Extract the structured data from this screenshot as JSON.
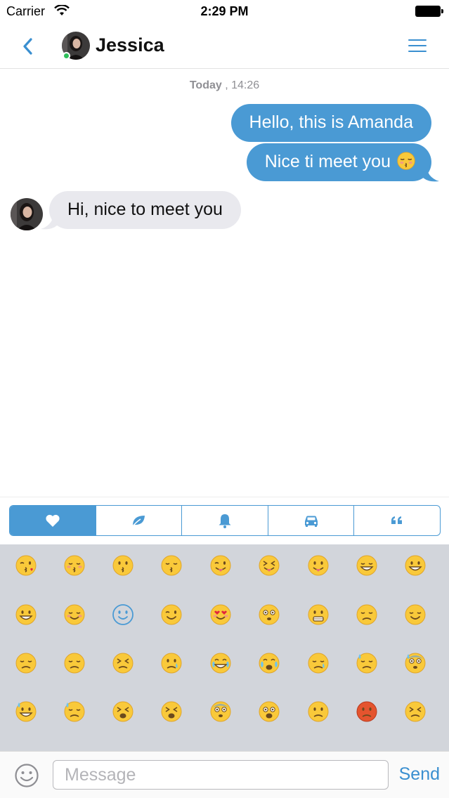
{
  "status_bar": {
    "carrier": "Carrier",
    "time": "2:29 PM"
  },
  "nav": {
    "contact_name": "Jessica",
    "online": true
  },
  "chat": {
    "date_day": "Today",
    "date_sep": " , ",
    "date_time": "14:26",
    "messages": [
      {
        "direction": "outgoing",
        "text": "Hello, this is Amanda"
      },
      {
        "direction": "outgoing",
        "text": "Nice ti meet you",
        "emoji": "kissing-closed-eyes"
      },
      {
        "direction": "incoming",
        "text": "Hi, nice to meet you"
      }
    ]
  },
  "emoji_categories": [
    {
      "name": "heart-icon",
      "active": true
    },
    {
      "name": "leaf-icon",
      "active": false
    },
    {
      "name": "bell-icon",
      "active": false
    },
    {
      "name": "car-icon",
      "active": false
    },
    {
      "name": "quote-icon",
      "active": false
    }
  ],
  "emoji_grid": [
    [
      "face-blowing-kiss",
      "kissing-closed-eyes",
      "kissing-face",
      "kissing-smiling-eyes",
      "winking-tongue",
      "squinting-tongue",
      "face-with-tongue",
      "grinning-smiling-eyes",
      "grinning-big-eyes"
    ],
    [
      "grinning-face",
      "smiling-blush",
      "white-smiling-face",
      "winking-face",
      "heart-eyes",
      "flushed-face",
      "grimacing-face",
      "pensive-face",
      "relieved-face"
    ],
    [
      "unamused-face",
      "disappointed-face",
      "confounded-face",
      "crying-face",
      "tears-of-joy",
      "loudly-crying",
      "sleepy-face",
      "worried-sweat",
      "anxious-sweat"
    ],
    [
      "grinning-sweat",
      "downcast-sweat",
      "persevering-face",
      "weary-face",
      "fearful-face",
      "screaming-face",
      "angry-face",
      "pouting-face",
      "triumph-face"
    ]
  ],
  "composer": {
    "placeholder": "Message",
    "value": "",
    "send_label": "Send"
  },
  "colors": {
    "accent": "#4a9ad4",
    "incoming_bubble": "#e9e9ee",
    "panel_bg": "#d2d5db",
    "online": "#2ec05a"
  }
}
